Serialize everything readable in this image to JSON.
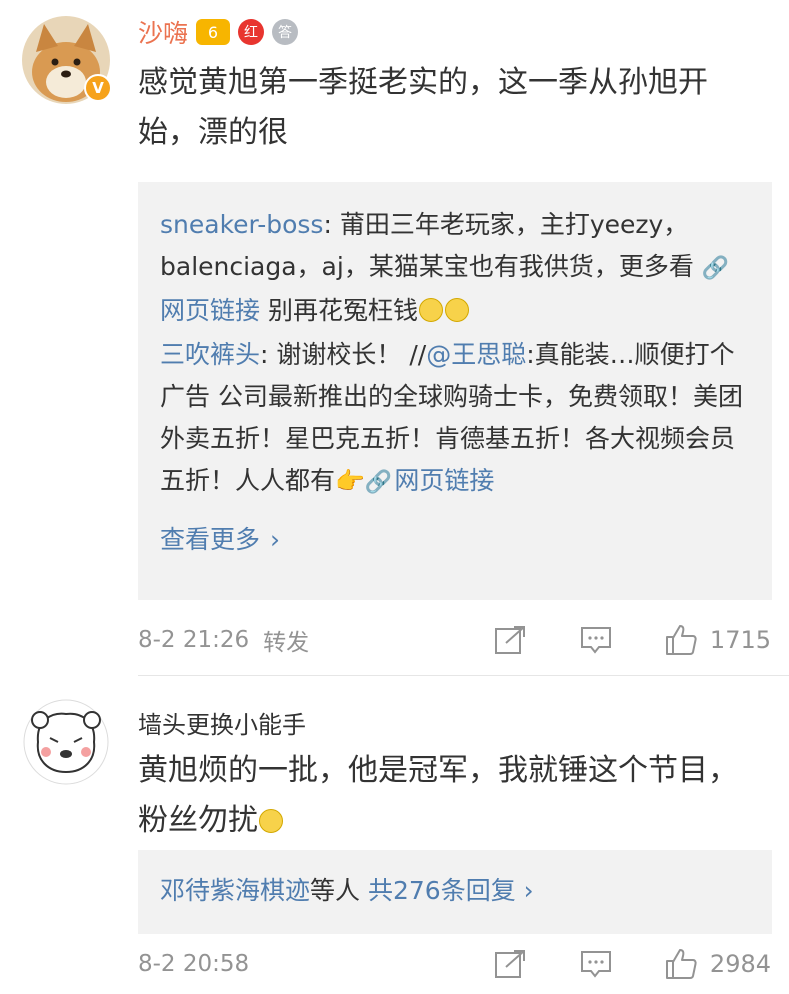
{
  "comments": [
    {
      "username": "沙嗨",
      "badges": [
        {
          "icon": "crown-level-badge-icon",
          "text": "6"
        },
        {
          "icon": "red-badge-icon",
          "text": "红"
        },
        {
          "icon": "silver-badge-icon",
          "text": "答"
        }
      ],
      "verified": "V",
      "text": "感觉黄旭第一季挺老实的，这一季从孙旭开始，漂的很",
      "replies": [
        {
          "name": "sneaker-boss",
          "separator": ": ",
          "text_before": "莆田三年老玩家，主打yeezy，balenciaga，aj，某猫某宝也有我供货，更多看 ",
          "link_text": "网页链接",
          "text_after": " 别再花冤枉钱"
        },
        {
          "name": "三吹裤头",
          "separator": ": ",
          "text_before": "谢谢校长！ //",
          "mention": "@王思聪",
          "text_after": ":真能装…顺便打个广告 公司最新推出的全球购骑士卡，免费领取！美团外卖五折！星巴克五折！肯德基五折！各大视频会员五折！人人都有",
          "link_text": "网页链接"
        }
      ],
      "more_label": "查看更多",
      "chevron": "›",
      "time": "8-2 21:26",
      "forward_label": "转发",
      "likes": "1715"
    },
    {
      "username": "墙头更换小能手",
      "text": "黄旭烦的一批，他是冠军，我就锤这个节目，粉丝勿扰",
      "replies_summary": {
        "names": "邓待紫海棋迹",
        "suffix": "等人",
        "count_label": "共276条回复",
        "chevron": "›"
      },
      "time": "8-2 20:58",
      "likes": "2984"
    }
  ],
  "colors": {
    "username_accent": "#eb7350",
    "link": "#507daf",
    "meta_gray": "#939393",
    "reply_bg": "#f2f2f2",
    "verified_badge": "#f6a21b"
  }
}
